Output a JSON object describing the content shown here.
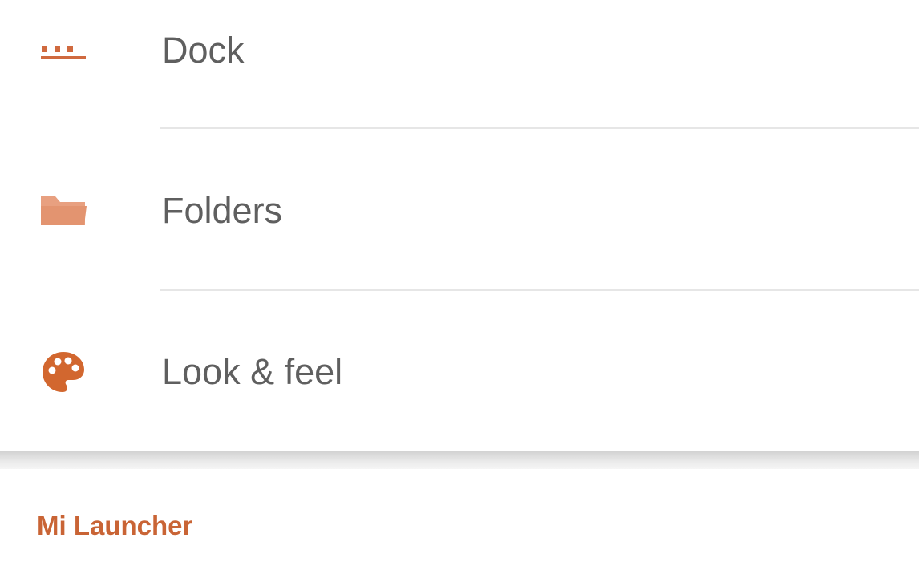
{
  "settings": {
    "items": [
      {
        "label": "Dock",
        "icon": "dock-icon"
      },
      {
        "label": "Folders",
        "icon": "folder-icon"
      },
      {
        "label": "Look & feel",
        "icon": "palette-icon"
      }
    ]
  },
  "section": {
    "title": "Mi Launcher"
  },
  "colors": {
    "accent": "#c96435",
    "folder_icon": "#e8a080",
    "label_text": "#5f5f5f",
    "divider": "#e6e6e6"
  }
}
